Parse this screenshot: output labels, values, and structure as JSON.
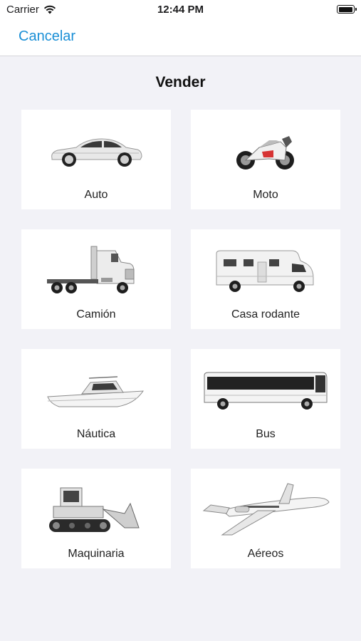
{
  "status_bar": {
    "carrier": "Carrier",
    "time": "12:44 PM",
    "battery_level": 0.9
  },
  "nav": {
    "cancel_label": "Cancelar"
  },
  "page": {
    "title": "Vender"
  },
  "categories": [
    {
      "label": "Auto",
      "icon": "car-icon"
    },
    {
      "label": "Moto",
      "icon": "motorcycle-icon"
    },
    {
      "label": "Camión",
      "icon": "truck-icon"
    },
    {
      "label": "Casa rodante",
      "icon": "motorhome-icon"
    },
    {
      "label": "Náutica",
      "icon": "boat-icon"
    },
    {
      "label": "Bus",
      "icon": "bus-icon"
    },
    {
      "label": "Maquinaria",
      "icon": "bulldozer-icon"
    },
    {
      "label": "Aéreos",
      "icon": "airplane-icon"
    }
  ]
}
